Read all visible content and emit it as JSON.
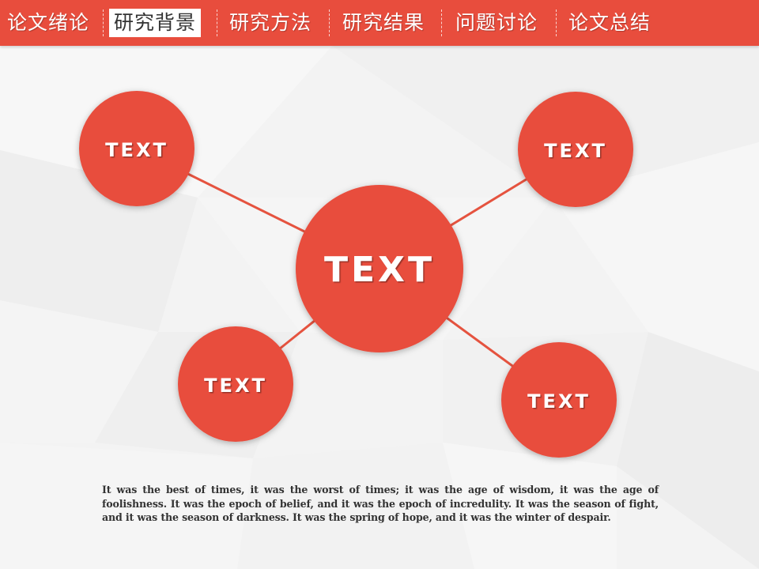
{
  "colors": {
    "accent": "#e84d3d",
    "node_fill": "#e84d3d",
    "connector": "#e5533f",
    "text_dark": "#333333"
  },
  "nav": {
    "tabs": [
      {
        "label": "论文绪论",
        "active": false
      },
      {
        "label": "研究背景",
        "active": true
      },
      {
        "label": "研究方法",
        "active": false
      },
      {
        "label": "研究结果",
        "active": false
      },
      {
        "label": "问题讨论",
        "active": false
      },
      {
        "label": "论文总结",
        "active": false
      }
    ]
  },
  "diagram": {
    "center": {
      "label": "TEXT"
    },
    "nodes": [
      {
        "id": "top-left",
        "label": "TEXT"
      },
      {
        "id": "top-right",
        "label": "TEXT"
      },
      {
        "id": "bottom-left",
        "label": "TEXT"
      },
      {
        "id": "bottom-right",
        "label": "TEXT"
      }
    ]
  },
  "caption": "It was the best of times, it was the worst of times; it was the age of wisdom, it was the age of foolishness. It was the epoch of belief, and it was the epoch of incredulity. It was the season of fight, and it was the season of darkness. It was the spring of hope, and it was the winter of despair."
}
